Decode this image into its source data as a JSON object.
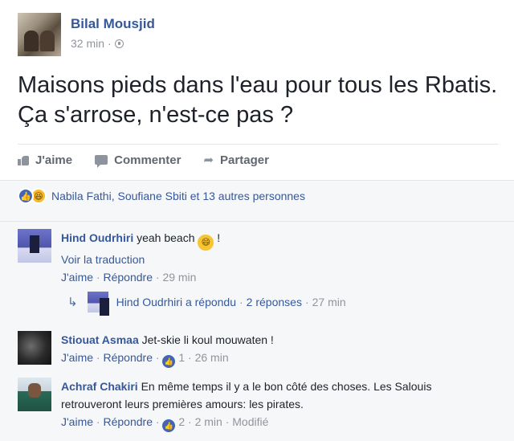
{
  "post": {
    "author": "Bilal Mousjid",
    "time": "32 min",
    "separator": "·",
    "text": "Maisons pieds dans l'eau pour tous les Rbatis. Ça s'arrose, n'est-ce pas ?"
  },
  "actions": {
    "like": "J'aime",
    "comment": "Commenter",
    "share": "Partager"
  },
  "reactions": {
    "names": "Nabila Fathi, Soufiane Sbiti et 13 autres personnes"
  },
  "comments": [
    {
      "author": "Hind Oudrhiri",
      "text": "yeah beach",
      "after_emoji": "!",
      "translate": "Voir la traduction",
      "like": "J'aime",
      "reply": "Répondre",
      "time": "29 min"
    },
    {
      "author": "Stiouat Asmaa",
      "text": "Jet-skie li koul mouwaten !",
      "like": "J'aime",
      "reply": "Répondre",
      "likes": "1",
      "time": "26 min"
    },
    {
      "author": "Achraf Chakiri",
      "text": "En même temps il y a le bon côté des choses. Les Salouis retrouveront leurs premières amours: les pirates.",
      "like": "J'aime",
      "reply": "Répondre",
      "likes": "2",
      "time": "2 min",
      "edited": "Modifié"
    }
  ],
  "reply_summary": {
    "text": "Hind Oudrhiri a répondu",
    "count": "2 réponses",
    "time": "27 min"
  },
  "colors": {
    "link": "#365899",
    "meta": "#90949c",
    "like_blue": "#4267b2",
    "haha_yellow": "#f7b928",
    "comment_bg": "#f6f7f9"
  },
  "icons": {
    "post_privacy": "globe-icon",
    "like": "thumbs-up-icon",
    "comment": "speech-bubble-icon",
    "share": "share-arrow-icon",
    "reply_summary": "reply-arrow-icon"
  }
}
